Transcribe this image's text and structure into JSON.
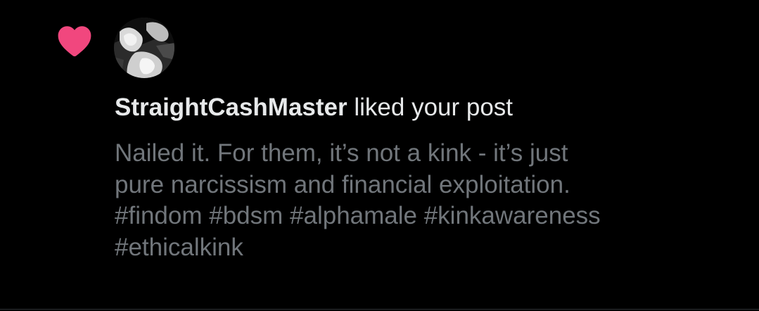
{
  "notification": {
    "type_icon": "heart-icon",
    "avatar_icon": "avatar-image",
    "username": "StraightCashMaster",
    "action": " liked your post",
    "post_lines": [
      "Nailed it. For them, it’s not a kink - it’s just",
      "pure narcissism and financial exploitation.",
      "#findom #bdsm #alphamale #kinkawareness",
      "#ethicalkink"
    ]
  },
  "colors": {
    "background": "#000000",
    "heart": "#f91880",
    "primary_text": "#e7e9ea",
    "secondary_text": "#71767b",
    "divider": "#2f3336"
  }
}
